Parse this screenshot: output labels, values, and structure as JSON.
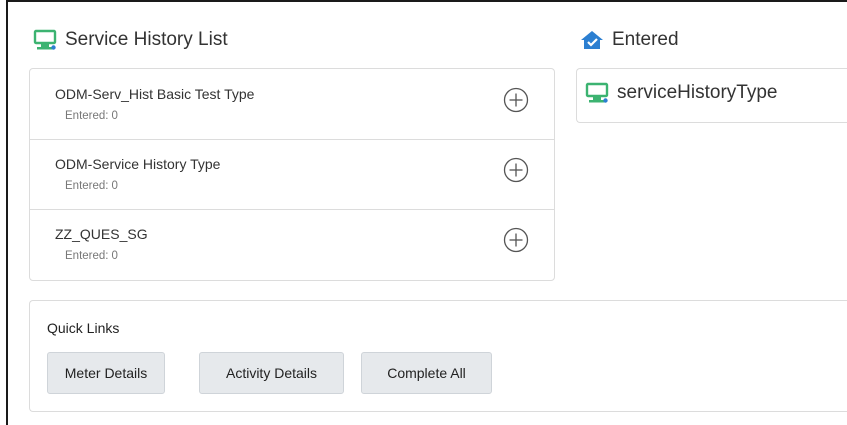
{
  "left_panel": {
    "title": "Service History List",
    "rows": [
      {
        "name": "ODM-Serv_Hist Basic Test Type",
        "entered_label": "Entered:",
        "entered_count": "0"
      },
      {
        "name": "ODM-Service History Type",
        "entered_label": "Entered:",
        "entered_count": "0"
      },
      {
        "name": "ZZ_QUES_SG",
        "entered_label": "Entered:",
        "entered_count": "0"
      }
    ]
  },
  "right_panel": {
    "title": "Entered",
    "items": [
      {
        "label": "serviceHistoryType"
      }
    ]
  },
  "quick_links": {
    "title": "Quick Links",
    "buttons": [
      {
        "label": "Meter Details"
      },
      {
        "label": "Activity Details"
      },
      {
        "label": "Complete All"
      }
    ]
  },
  "icons": {
    "title_left": "monitor-icon",
    "title_right": "house-check-icon",
    "entered_item": "monitor-icon",
    "row_action": "plus-circle-icon"
  },
  "colors": {
    "accent_green": "#3cb371",
    "accent_blue": "#2c7fd1",
    "border": "#dcdcdc",
    "button_bg": "#e6e9ec"
  }
}
